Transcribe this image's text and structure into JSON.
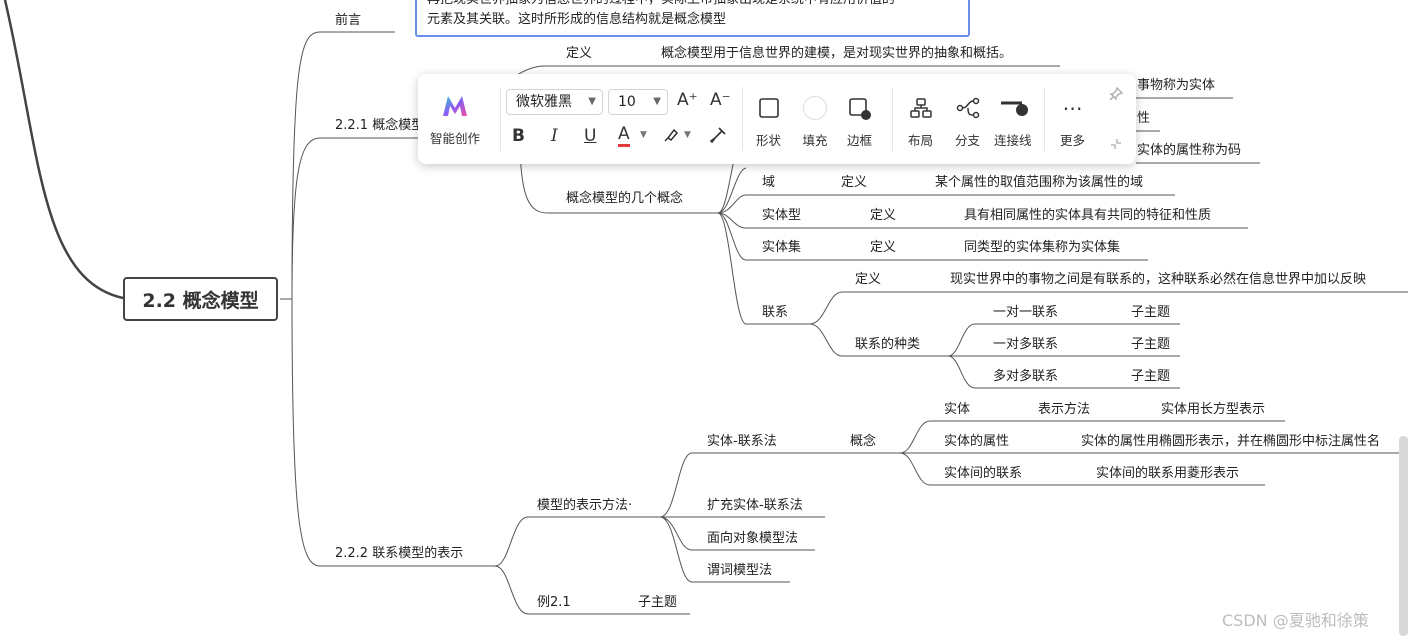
{
  "root": "2.2 概念模型",
  "note": {
    "line1": "再把现实世界抽象为信息世界的过程中，实际上市抽象出现是系统中有应用价值的",
    "line2": "元素及其关联。这时所形成的信息结构就是概念模型"
  },
  "branches": {
    "preface": "前言",
    "b221": "2.2.1 概念模型",
    "b222": "2.2.2 联系模型的表示"
  },
  "b221_children": {
    "def_label": "定义",
    "def_text": "概念模型用于信息世界的建模，是对现实世界的抽象和概括。",
    "concepts": "概念模型的几个概念",
    "hidden_entity": "事物称为实体",
    "hidden_attr": "性",
    "hidden_code": "实体的属性称为码",
    "domain": "域",
    "domain_def": "定义",
    "domain_text": "某个属性的取值范围称为该属性的域",
    "etype": "实体型",
    "etype_def": "定义",
    "etype_text": "具有相同属性的实体具有共同的特征和性质",
    "eset": "实体集",
    "eset_def": "定义",
    "eset_text": "同类型的实体集称为实体集",
    "relation": "联系",
    "rel_def": "定义",
    "rel_def_text": "现实世界中的事物之间是有联系的，这种联系必然在信息世界中加以反映",
    "rel_kinds": "联系的种类",
    "one_one": "一对一联系",
    "one_many": "一对多联系",
    "many_many": "多对多联系",
    "sub1": "子主题",
    "sub2": "子主题",
    "sub3": "子主题"
  },
  "b222_children": {
    "methods": "模型的表示方法·",
    "er": "实体-联系法",
    "concept": "概念",
    "entity": "实体",
    "entity_method": "表示方法",
    "entity_text": "实体用长方型表示",
    "entity_attr": "实体的属性",
    "entity_attr_text": "实体的属性用椭圆形表示，并在椭圆形中标注属性名",
    "entity_rel": "实体间的联系",
    "entity_rel_text": "实体间的联系用菱形表示",
    "ext_er": "扩充实体-联系法",
    "oo": "面向对象模型法",
    "pred": "谓词模型法",
    "example": "例2.1",
    "example_sub": "子主题"
  },
  "toolbar": {
    "ai_label": "智能创作",
    "font_family": "微软雅黑",
    "font_size": "10",
    "grow_label": "A⁺",
    "shrink_label": "A⁻",
    "bold_label": "B",
    "italic_label": "I",
    "underline_label": "U",
    "color_label": "A",
    "shape_label": "形状",
    "fill_label": "填充",
    "border_label": "边框",
    "layout_label": "布局",
    "branch_label": "分支",
    "connector_label": "连接线",
    "more_label": "更多",
    "accent": "#e03a3a"
  },
  "watermark": "CSDN @夏驰和徐策"
}
